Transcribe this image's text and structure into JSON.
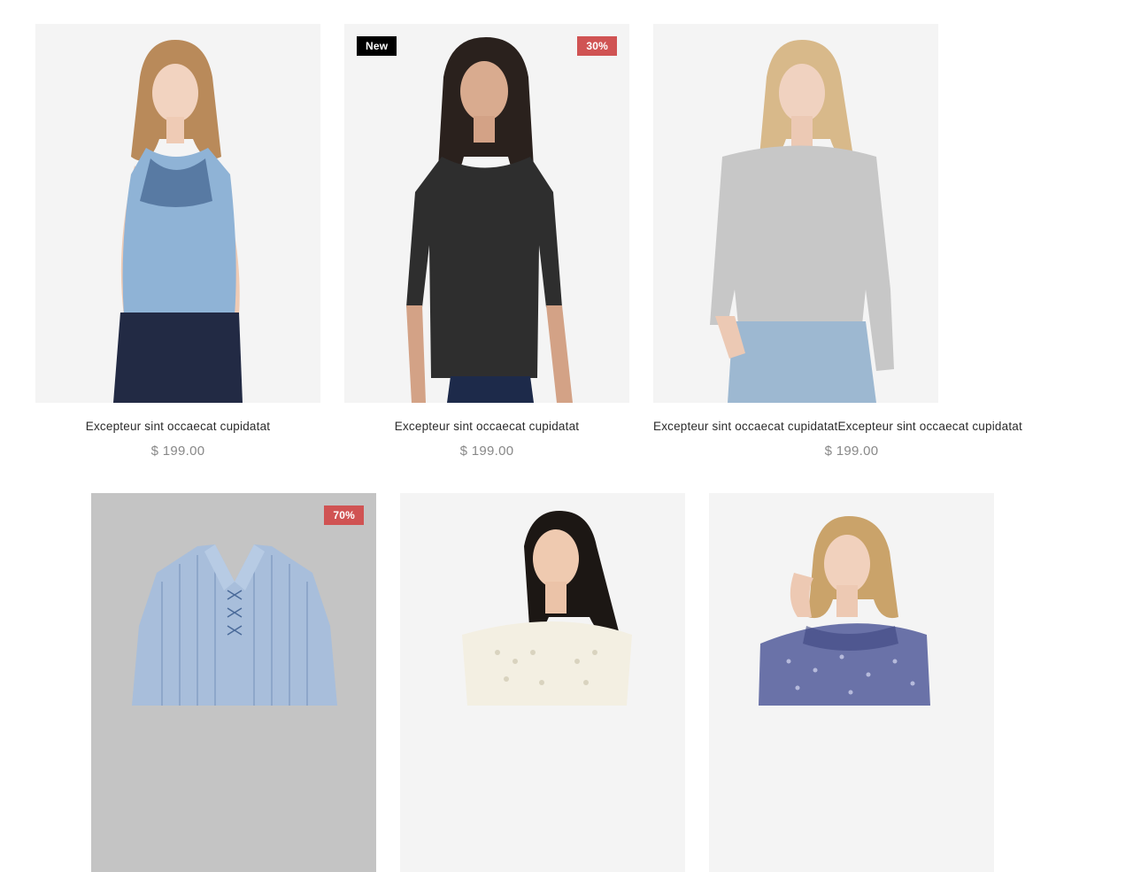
{
  "products": [
    {
      "title": "Excepteur sint occaecat cupidatat",
      "price": "$ 199.00",
      "badge_new": "",
      "badge_sale": ""
    },
    {
      "title": "Excepteur sint occaecat cupidatat",
      "price": "$ 199.00",
      "badge_new": "New",
      "badge_sale": "30%"
    },
    {
      "title": "Excepteur sint occaecat cupidatatExcepteur sint occaecat cupidatat",
      "price": "$ 199.00",
      "badge_new": "",
      "badge_sale": ""
    },
    {
      "title": "",
      "price": "",
      "badge_new": "",
      "badge_sale": "70%"
    },
    {
      "title": "",
      "price": "",
      "badge_new": "",
      "badge_sale": ""
    },
    {
      "title": "",
      "price": "",
      "badge_new": "",
      "badge_sale": ""
    }
  ],
  "colors": {
    "sale_badge": "#d05353",
    "new_badge": "#000000",
    "price_text": "#888888"
  }
}
